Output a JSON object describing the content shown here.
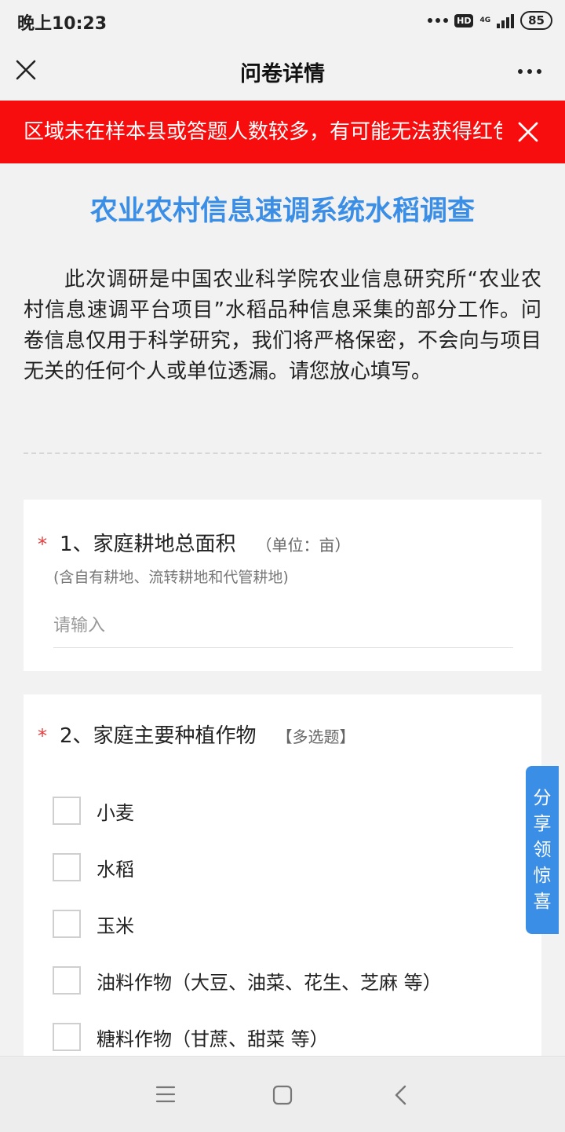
{
  "status_bar": {
    "time": "晚上10:23",
    "hd": "HD",
    "network": "4G",
    "battery": "85"
  },
  "nav": {
    "title": "问卷详情"
  },
  "notice": {
    "text": "区域未在样本县或答题人数较多，有可能无法获得红包"
  },
  "survey": {
    "title": "农业农村信息速调系统水稻调查",
    "intro": "此次调研是中国农业科学院农业信息研究所“农业农村信息速调平台项目”水稻品种信息采集的部分工作。问卷信息仅用于科学研究，我们将严格保密，不会向与项目无关的任何个人或单位透漏。请您放心填写。"
  },
  "questions": [
    {
      "required_mark": "*",
      "title": "1、家庭耕地总面积",
      "unit": "（单位：亩）",
      "hint": "(含自有耕地、流转耕地和代管耕地)",
      "placeholder": "请输入"
    },
    {
      "required_mark": "*",
      "title": "2、家庭主要种植作物",
      "type_label": "【多选题】",
      "options": [
        "小麦",
        "水稻",
        "玉米",
        "油料作物（大豆、油菜、花生、芝麻 等）",
        "糖料作物（甘蔗、甜菜 等）"
      ]
    }
  ],
  "share_tab": [
    "分",
    "享",
    "领",
    "惊",
    "喜"
  ],
  "icons": {
    "close": "close-icon",
    "more": "more-dots-icon",
    "notice_close": "close-icon",
    "menu": "menu-icon",
    "home": "home-square-icon",
    "back": "back-chevron-icon"
  },
  "colors": {
    "accent": "#3a8ee6",
    "notice_bg": "#f70d0d",
    "required": "#e83a3a"
  }
}
